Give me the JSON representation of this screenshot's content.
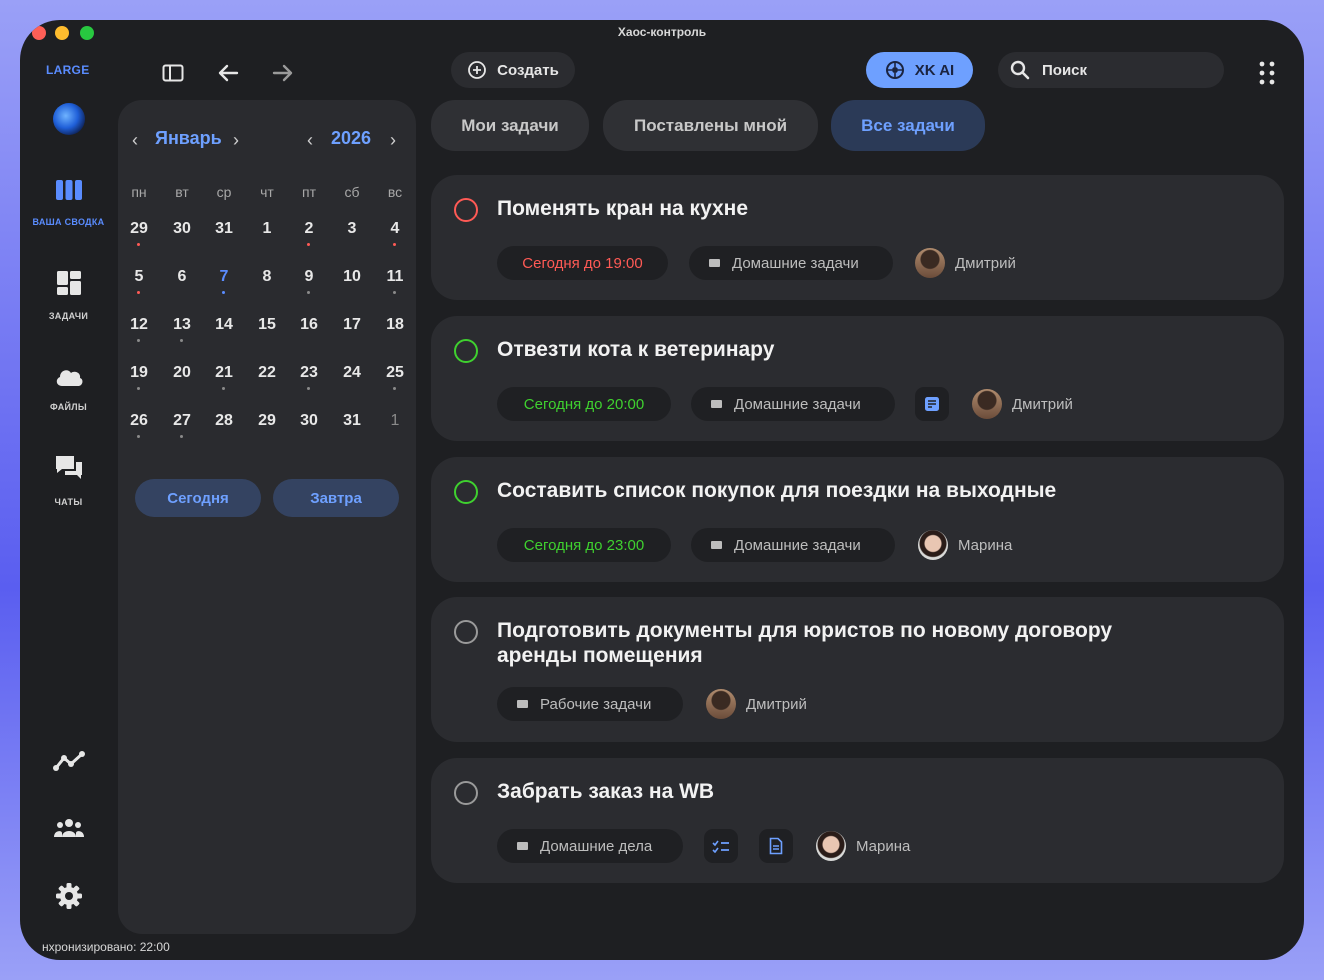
{
  "window": {
    "title": "Хаос-контроль"
  },
  "sidebar": {
    "brand": "LARGE",
    "nav": [
      {
        "label": "ВАША СВОДКА",
        "icon": "columns-icon",
        "active": true
      },
      {
        "label": "ЗАДАЧИ",
        "icon": "dashboard-icon"
      },
      {
        "label": "ФАЙЛЫ",
        "icon": "cloud-icon"
      },
      {
        "label": "ЧАТЫ",
        "icon": "chat-icon"
      }
    ],
    "bottom_icons": [
      "analytics-icon",
      "team-icon",
      "settings-icon"
    ],
    "sync_status": "нхронизировано: 22:00"
  },
  "toolbar": {
    "create_label": "Создать",
    "ai_label": "XK AI",
    "search_placeholder": "Поиск"
  },
  "calendar": {
    "month": "Январь",
    "year": "2026",
    "weekdays": [
      "пн",
      "вт",
      "ср",
      "чт",
      "пт",
      "сб",
      "вс"
    ],
    "weeks": [
      [
        "29",
        "30",
        "31",
        "1",
        "2",
        "3",
        "4"
      ],
      [
        "5",
        "6",
        "7",
        "8",
        "9",
        "10",
        "11"
      ],
      [
        "12",
        "13",
        "14",
        "15",
        "16",
        "17",
        "18"
      ],
      [
        "19",
        "20",
        "21",
        "22",
        "23",
        "24",
        "25"
      ],
      [
        "26",
        "27",
        "28",
        "29",
        "30",
        "31",
        "1"
      ]
    ],
    "today": "Сегодня",
    "tomorrow": "Завтра"
  },
  "tabs": [
    {
      "label": "Мои задачи"
    },
    {
      "label": "Поставлены мной"
    },
    {
      "label": "Все задачи",
      "active": true
    }
  ],
  "tasks": [
    {
      "title": "Поменять кран на кухне",
      "deadline": "Сегодня до 19:00",
      "folder": "Домашние задачи",
      "assignee": "Дмитрий"
    },
    {
      "title": "Отвезти кота к ветеринару",
      "deadline": "Сегодня до 20:00",
      "folder": "Домашние задачи",
      "assignee": "Дмитрий"
    },
    {
      "title": "Составить список покупок для поездки на выходные",
      "deadline": "Сегодня до 23:00",
      "folder": "Домашние задачи",
      "assignee": "Марина"
    },
    {
      "title_line1": "Подготовить документы для юристов по новому договору",
      "title_line2": "аренды помещения",
      "folder": "Рабочие задачи",
      "assignee": "Дмитрий"
    },
    {
      "title": "Забрать заказ на WB",
      "folder": "Домашние дела",
      "assignee": "Марина"
    }
  ],
  "colors": {
    "accent": "#5a8cff",
    "overdue": "#ff5a55",
    "ok": "#3fd12f",
    "neutral": "#9a9a9a"
  }
}
